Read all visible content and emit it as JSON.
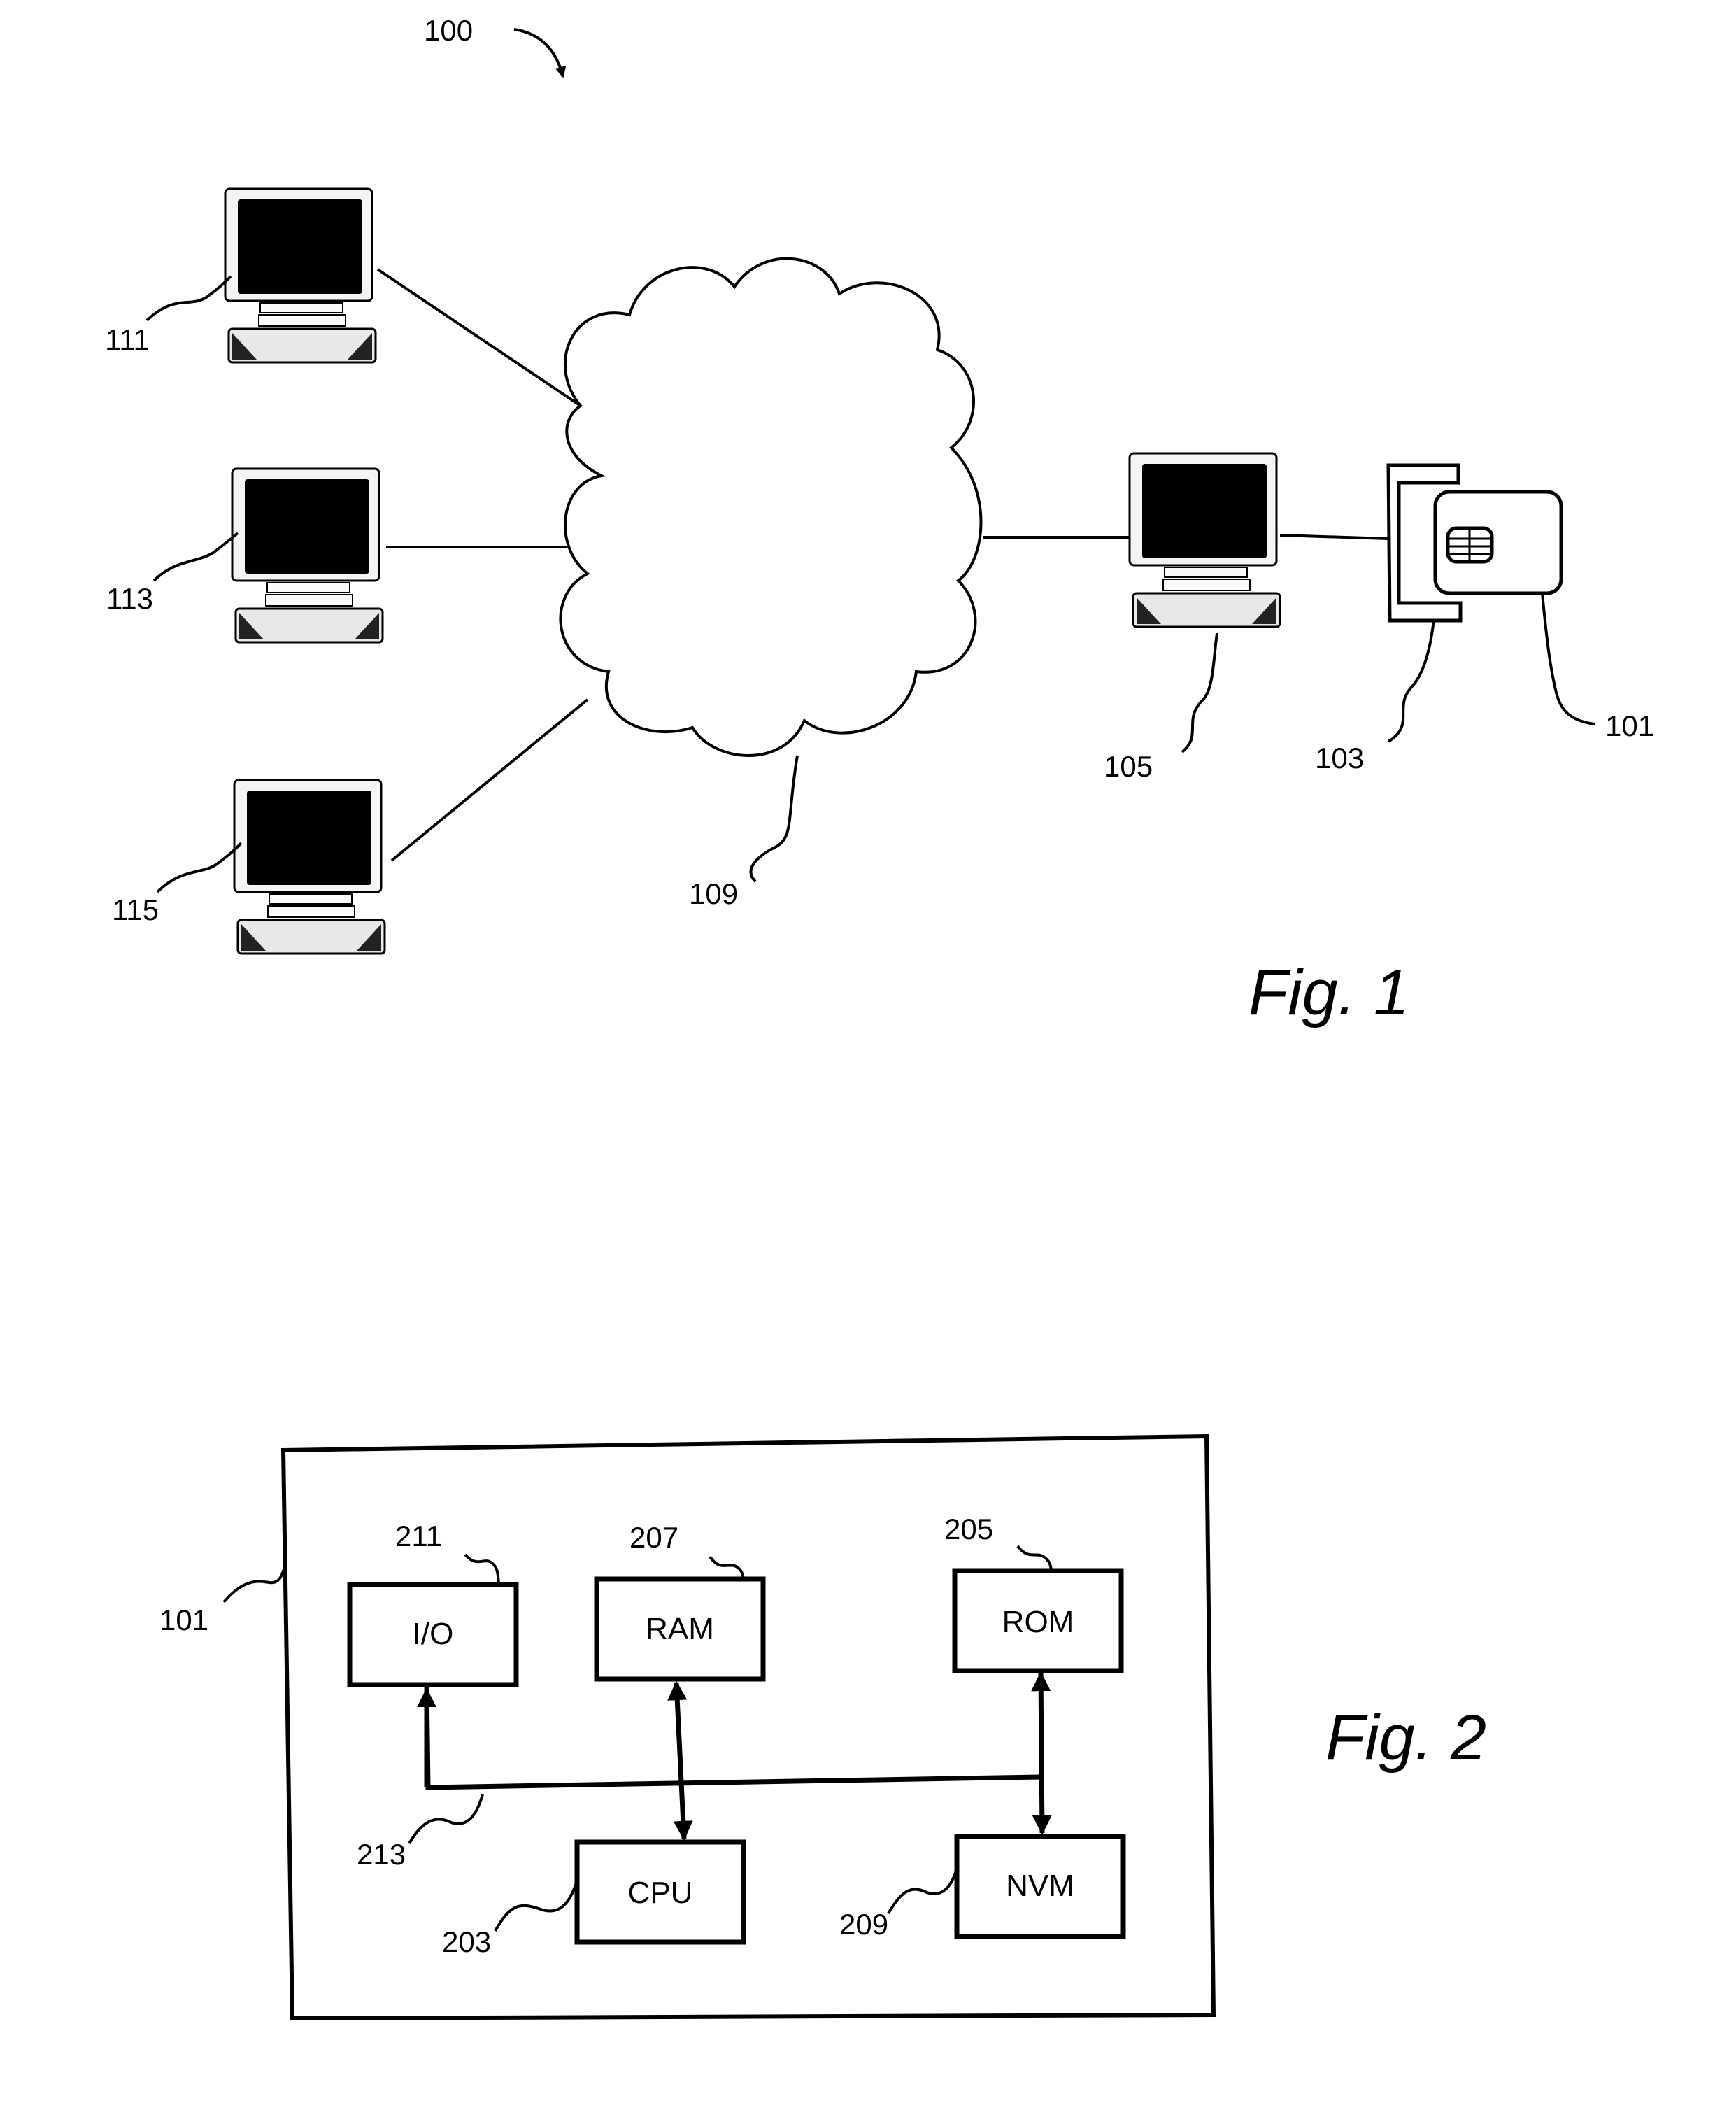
{
  "figure1": {
    "caption": "Fig. 1",
    "system_label": "100",
    "network_label": "109",
    "computers": [
      {
        "id": "computer-111",
        "label": "111"
      },
      {
        "id": "computer-113",
        "label": "113"
      },
      {
        "id": "computer-115",
        "label": "115"
      },
      {
        "id": "computer-105",
        "label": "105"
      }
    ],
    "card_reader_label": "103",
    "smart_card_label": "101"
  },
  "figure2": {
    "caption": "Fig. 2",
    "card_label": "101",
    "bus_label": "213",
    "blocks": [
      {
        "name": "I/O",
        "ref": "211"
      },
      {
        "name": "RAM",
        "ref": "207"
      },
      {
        "name": "ROM",
        "ref": "205"
      },
      {
        "name": "CPU",
        "ref": "203"
      },
      {
        "name": "NVM",
        "ref": "209"
      }
    ]
  }
}
